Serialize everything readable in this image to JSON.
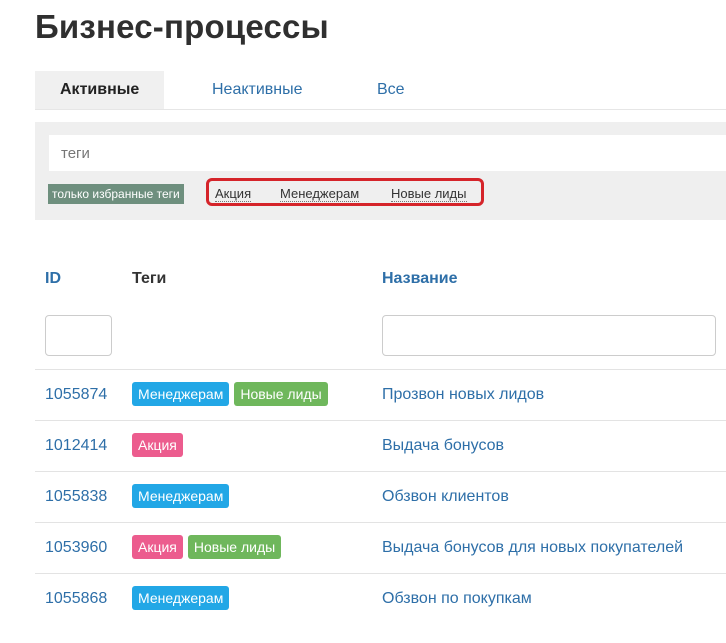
{
  "page": {
    "title": "Бизнес-процессы"
  },
  "tabs": [
    {
      "label": "Активные",
      "active": true
    },
    {
      "label": "Неактивные",
      "active": false
    },
    {
      "label": "Все",
      "active": false
    }
  ],
  "filter": {
    "tags_placeholder": "теги",
    "favorites_label": "только избранные теги",
    "tag_options": [
      "Акция",
      "Менеджерам",
      "Новые лиды"
    ]
  },
  "table": {
    "columns": {
      "id": "ID",
      "tags": "Теги",
      "name": "Название"
    },
    "rows": [
      {
        "id": "1055874",
        "tags": [
          {
            "label": "Менеджерам",
            "color": "blue"
          },
          {
            "label": "Новые лиды",
            "color": "green"
          }
        ],
        "name": "Прозвон новых лидов"
      },
      {
        "id": "1012414",
        "tags": [
          {
            "label": "Акция",
            "color": "pink"
          }
        ],
        "name": "Выдача бонусов"
      },
      {
        "id": "1055838",
        "tags": [
          {
            "label": "Менеджерам",
            "color": "blue"
          }
        ],
        "name": "Обзвон клиентов"
      },
      {
        "id": "1053960",
        "tags": [
          {
            "label": "Акция",
            "color": "pink"
          },
          {
            "label": "Новые лиды",
            "color": "green"
          }
        ],
        "name": "Выдача бонусов для новых покупателей"
      },
      {
        "id": "1055868",
        "tags": [
          {
            "label": "Менеджерам",
            "color": "blue"
          }
        ],
        "name": "Обзвон по покупкам"
      }
    ]
  },
  "colors": {
    "link": "#2e6fa8",
    "tag_blue": "#22a7e6",
    "tag_green": "#6fb75c",
    "tag_pink": "#ec5c8e",
    "favorites_badge": "#6e8f7e",
    "highlight_border": "#d5242a"
  }
}
